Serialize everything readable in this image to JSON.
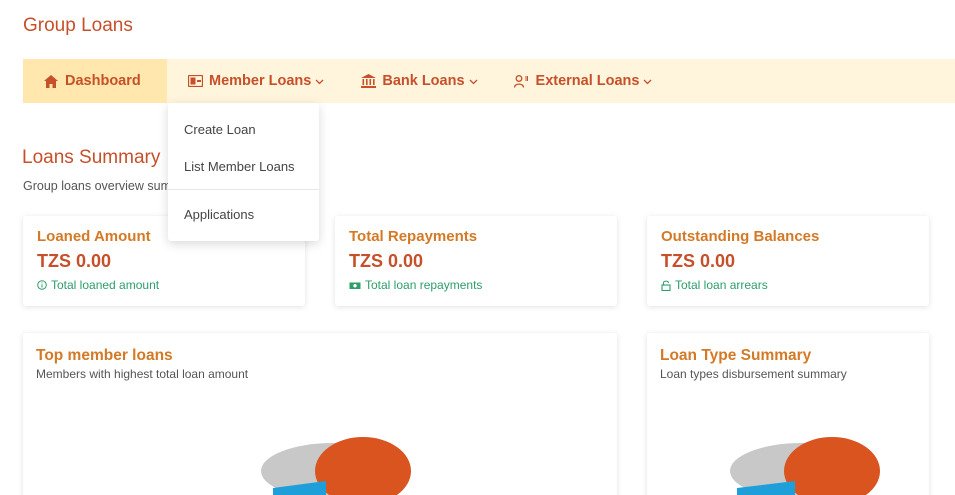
{
  "app": {
    "title": "Group Loans"
  },
  "nav": {
    "items": [
      {
        "label": "Dashboard",
        "icon": "home-icon",
        "active": true
      },
      {
        "label": "Member Loans",
        "icon": "wallet-icon",
        "dropdown": true
      },
      {
        "label": "Bank Loans",
        "icon": "bank-icon",
        "dropdown": true
      },
      {
        "label": "External Loans",
        "icon": "user-exchange-icon",
        "dropdown": true
      }
    ]
  },
  "dropdown": {
    "items": [
      "Create Loan",
      "List Member Loans",
      "Applications"
    ]
  },
  "summary": {
    "title": "Loans Summary",
    "subtitle": "Group loans overview summary"
  },
  "stats": [
    {
      "title": "Loaned Amount",
      "value": "TZS 0.00",
      "note": "Total loaned amount",
      "icon": "info-circle-icon"
    },
    {
      "title": "Total Repayments",
      "value": "TZS 0.00",
      "note": "Total loan repayments",
      "icon": "money-icon"
    },
    {
      "title": "Outstanding Balances",
      "value": "TZS 0.00",
      "note": "Total loan arrears",
      "icon": "lock-icon"
    }
  ],
  "charts": {
    "top_member_loans": {
      "title": "Top member loans",
      "subtitle": "Members with highest total loan amount"
    },
    "loan_type_summary": {
      "title": "Loan Type Summary",
      "subtitle": "Loan types disbursement summary"
    }
  },
  "colors": {
    "accent": "#c6502a",
    "title_orange": "#d47a26",
    "note_green": "#2e9e6a",
    "nav_bg": "#fff5dc",
    "nav_active_bg": "#ffe7ad",
    "pie_orange": "#d9541f",
    "pie_blue": "#1e9fd9",
    "pie_grey": "#c8c8c8"
  }
}
